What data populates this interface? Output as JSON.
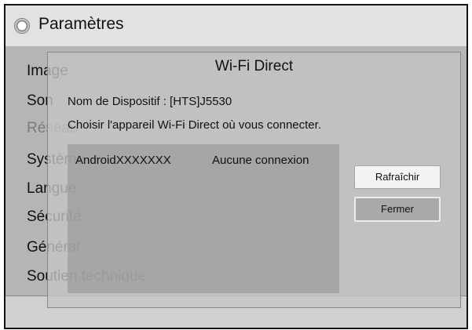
{
  "window": {
    "title": "Paramètres",
    "icon": "settings-disc-icon"
  },
  "menu": {
    "items": [
      {
        "label": "Image"
      },
      {
        "label": "Son"
      },
      {
        "label": "Réseau"
      },
      {
        "label": "Système"
      },
      {
        "label": "Langue"
      },
      {
        "label": "Sécurité"
      },
      {
        "label": "Général"
      },
      {
        "label": "Soutien technique"
      }
    ]
  },
  "dialog": {
    "title": "Wi-Fi Direct",
    "device_name_label": "Nom de Dispositif : [HTS]J5530",
    "instruction": "Choisir l'appareil Wi-Fi Direct où vous connecter.",
    "devices": [
      {
        "name": "AndroidXXXXXXX",
        "status": "Aucune connexion"
      }
    ],
    "buttons": {
      "refresh": "Rafraîchir",
      "close": "Fermer"
    }
  }
}
